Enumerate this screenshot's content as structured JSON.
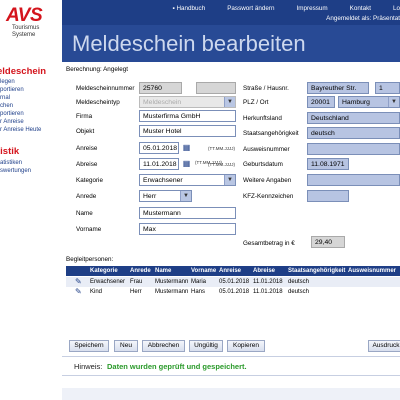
{
  "sidebar": {
    "logo_mark": "AVS",
    "logo_sub1": "Tourismus",
    "logo_sub2": "Systeme",
    "section1": "eldeschein",
    "items1": [
      "legen",
      "portieren",
      "rnal",
      "chen",
      "portieren",
      "r Anreise",
      "r Anreise Heute"
    ],
    "section2": "tistik",
    "items2": [
      "atistiken",
      "swertungen"
    ]
  },
  "header": {
    "links": [
      "Handbuch",
      "Passwort ändern",
      "Impressum",
      "Kontakt",
      "Lo"
    ],
    "logged_in": "Angemeldet als: Präsentat",
    "title": "Meldeschein bearbeiten"
  },
  "calc_text": "Berechnung: Angelegt",
  "form": {
    "meldescheinnummer_label": "Meldescheinnummer",
    "meldescheinnummer_value": "25760",
    "meldescheintyp_label": "Meldescheintyp",
    "meldescheintyp_value": "Meldeschein",
    "firma_label": "Firma",
    "firma_value": "Musterfirma GmbH",
    "objekt_label": "Objekt",
    "objekt_value": "Muster Hotel",
    "anreise_label": "Anreise",
    "anreise_value": "05.01.2018",
    "abreise_label": "Abreise",
    "abreise_value": "11.01.2018",
    "date_hint": "(TT.MM.JJJJ)",
    "kategorie_label": "Kategorie",
    "kategorie_value": "Erwachsener",
    "anrede_label": "Anrede",
    "anrede_value": "Herr",
    "name_label": "Name",
    "name_value": "Mustermann",
    "vorname_label": "Vorname",
    "vorname_value": "Max",
    "strasse_label": "Straße / Hausnr.",
    "strasse_value": "Bayreuther Str.",
    "hausnr_value": "1",
    "plz_label": "PLZ / Ort",
    "plz_value": "20001",
    "ort_value": "Hamburg",
    "herkunft_label": "Herkunftsland",
    "herkunft_value": "Deutschland",
    "staat_label": "Staatsangehörigkeit",
    "staat_value": "deutsch",
    "ausweis_label": "Ausweisnummer",
    "geburt_label": "Geburtsdatum",
    "geburt_value": "11.08.1971",
    "weitere_label": "Weitere Angaben",
    "kfz_label": "KFZ-Kennzeichen",
    "gesamt_label": "Gesamtbetrag in €",
    "gesamt_value": "29,40"
  },
  "companions": {
    "title": "Begleitpersonen:",
    "columns": [
      "Kategorie",
      "Anrede",
      "Name",
      "Vorname",
      "Anreise",
      "Abreise",
      "Staatsangehörigkeit",
      "Ausweisnummer"
    ],
    "rows": [
      [
        "Erwachsener",
        "Frau",
        "Mustermann",
        "Maria",
        "05.01.2018",
        "11.01.2018",
        "deutsch",
        ""
      ],
      [
        "Kind",
        "Herr",
        "Mustermann",
        "Hans",
        "05.01.2018",
        "11.01.2018",
        "deutsch",
        ""
      ]
    ]
  },
  "buttons": [
    "Speichern",
    "Neu",
    "Abbrechen",
    "Ungültig",
    "Kopieren",
    "Ausdruck"
  ],
  "footer": {
    "hinweis_label": "Hinweis:",
    "message": "Daten wurden geprüft und gespeichert."
  },
  "colors": {
    "brand_red": "#d4141c",
    "header_blue": "#1e3e86",
    "success_green": "#2a9a2a"
  }
}
